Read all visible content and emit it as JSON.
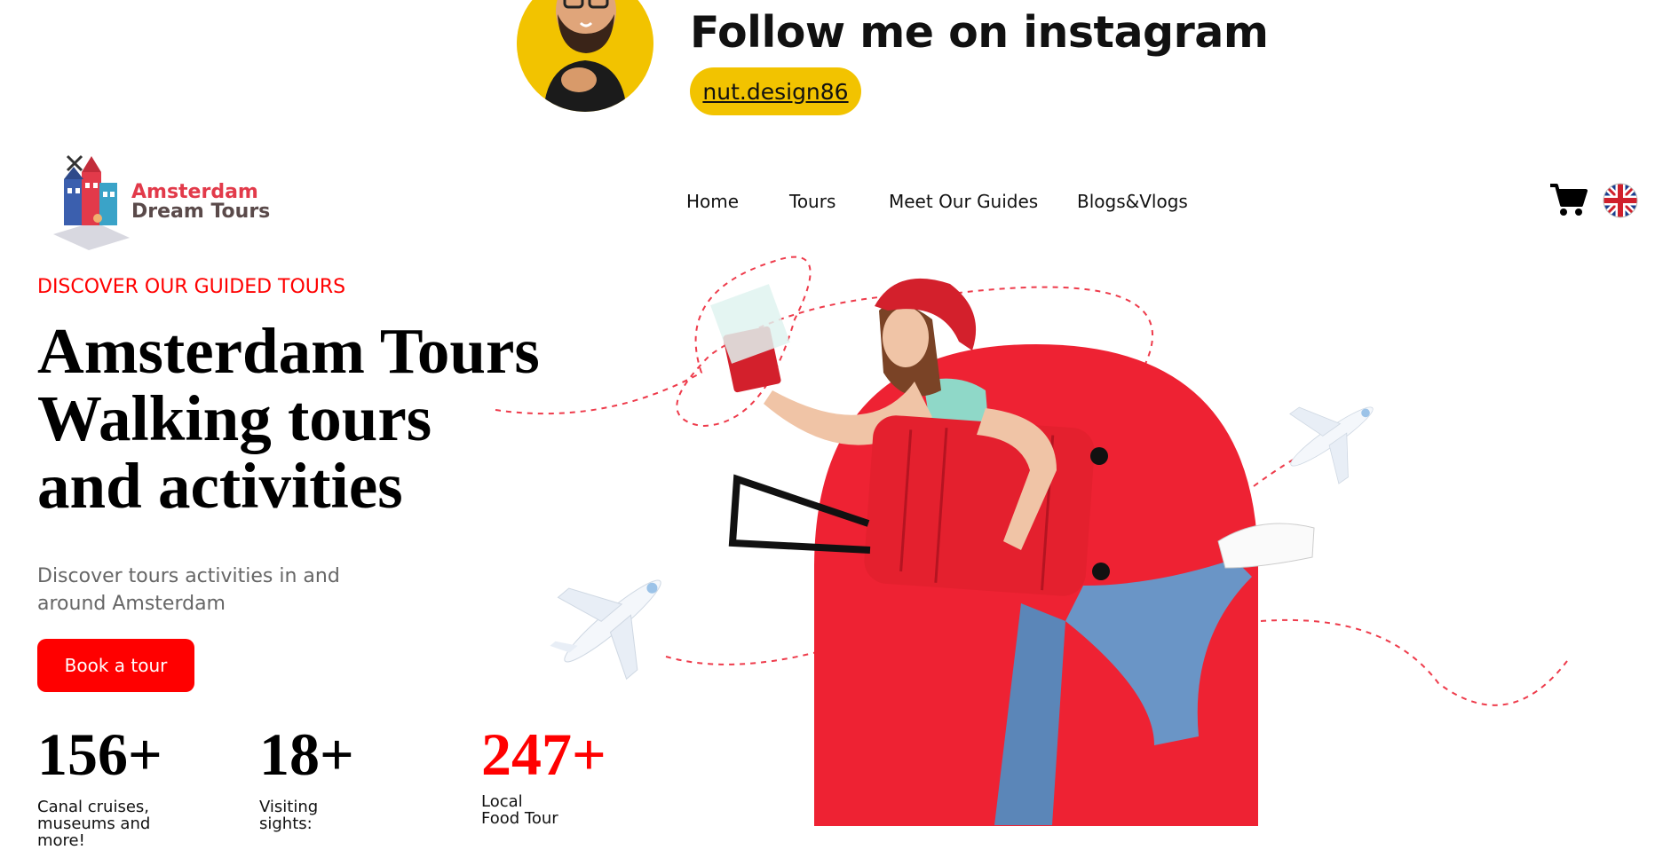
{
  "banner": {
    "title": "Follow me on instagram",
    "handle": "nut.design86",
    "accent": "#f2c300"
  },
  "header": {
    "logo_line1": "Amsterdam",
    "logo_line2": "Dream Tours",
    "nav": [
      "Home",
      "Tours",
      "Meet Our Guides",
      "Blogs&Vlogs"
    ],
    "icons": [
      "cart-icon",
      "uk-flag-icon"
    ]
  },
  "hero": {
    "eyebrow": "DISCOVER OUR GUIDED TOURS",
    "headline": [
      "Amsterdam Tours",
      "Walking tours",
      "and activities"
    ],
    "subtitle": "Discover tours activities in and around Amsterdam",
    "cta": "Book a tour",
    "brand_color": "#ff0000",
    "arch_color": "#ee2233"
  },
  "stats": [
    {
      "value": "156+",
      "label": "Canal cruises, museums and more!",
      "color": "#000000"
    },
    {
      "value": "18+",
      "label": "Visiting sights:",
      "color": "#000000"
    },
    {
      "value": "247+",
      "label": "Local Food Tour",
      "color": "#ff0000"
    }
  ]
}
